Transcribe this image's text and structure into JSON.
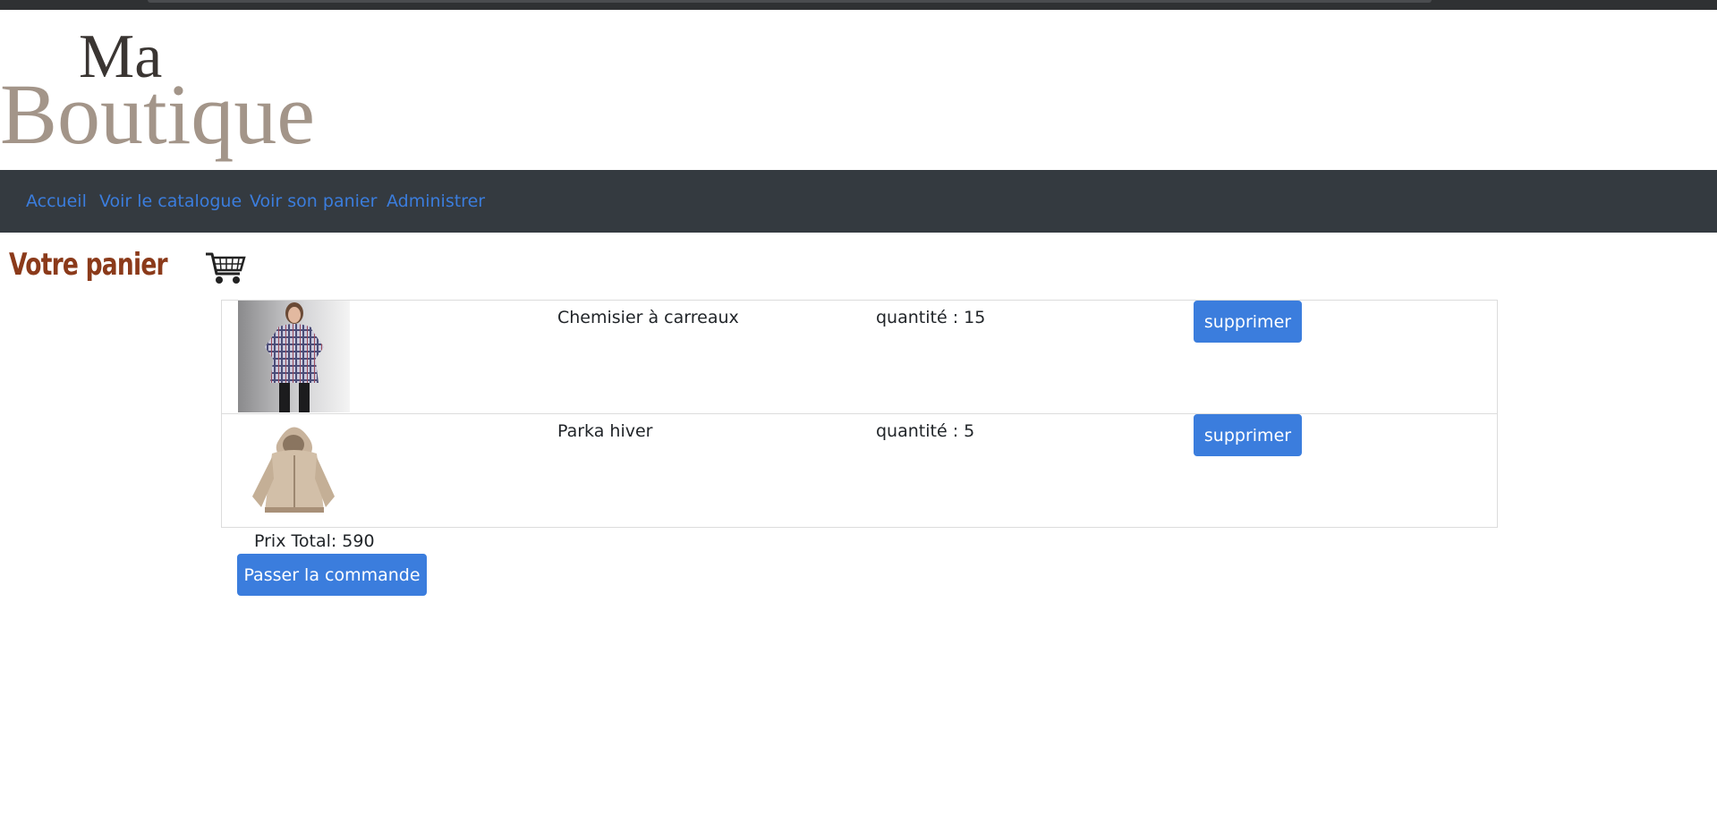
{
  "brand": {
    "logo_line1": "Ma",
    "logo_line2": "Boutique"
  },
  "nav": {
    "items": [
      {
        "label": "Accueil"
      },
      {
        "label": "Voir le catalogue"
      },
      {
        "label": "Voir son panier"
      },
      {
        "label": "Administrer"
      }
    ]
  },
  "page": {
    "title": "Votre panier",
    "cart_icon": "shopping-cart-icon"
  },
  "cart": {
    "items": [
      {
        "name": "Chemisier à carreaux",
        "quantity": "quantité : 15",
        "delete_label": "supprimer",
        "image": "plaid-shirt-woman"
      },
      {
        "name": "Parka hiver",
        "quantity": "quantité : 5",
        "delete_label": "supprimer",
        "image": "beige-hooded-parka"
      }
    ],
    "total_label": "Prix Total: 590",
    "order_label": "Passer la commande"
  },
  "colors": {
    "nav_bg": "#343a40",
    "link": "#3b7ddd",
    "button": "#3b7ddd",
    "title": "#8b3a1a"
  }
}
